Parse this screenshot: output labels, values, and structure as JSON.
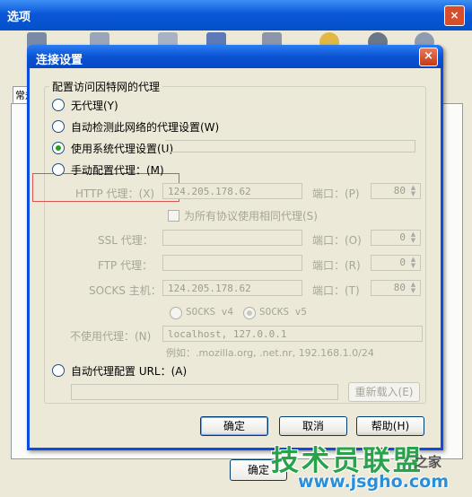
{
  "outer": {
    "title": "选项",
    "tab_label": "常规",
    "ok_label": "确定",
    "close_glyph": "×"
  },
  "dialog": {
    "title": "连接设置",
    "close_glyph": "×",
    "group_title": "配置访问因特网的代理",
    "options": {
      "no_proxy": "无代理(Y)",
      "auto_detect": "自动检测此网络的代理设置(W)",
      "system": "使用系统代理设置(U)",
      "manual": "手动配置代理：(M)",
      "auto_url": "自动代理配置 URL：(A)"
    },
    "selected_option": "system",
    "http": {
      "label": "HTTP 代理：(X)",
      "value": "124.205.178.62",
      "port_label": "端口：(P)",
      "port": "80"
    },
    "same_proxy_label": "为所有协议使用相同代理(S)",
    "ssl": {
      "label": "SSL 代理：",
      "value": "",
      "port_label": "端口：(O)",
      "port": "0"
    },
    "ftp": {
      "label": "FTP 代理：",
      "value": "",
      "port_label": "端口：(R)",
      "port": "0"
    },
    "socks": {
      "label": "SOCKS 主机：",
      "value": "124.205.178.62",
      "port_label": "端口：(T)",
      "port": "80"
    },
    "socks_v4": "SOCKS v4",
    "socks_v5": "SOCKS v5",
    "no_proxy_for_label": "不使用代理：(N)",
    "no_proxy_for_value": "localhost, 127.0.0.1",
    "example": "例如：.mozilla.org, .net.nr, 192.168.1.0/24",
    "reload_label": "重新载入(E)",
    "buttons": {
      "ok": "确定",
      "cancel": "取消",
      "help": "帮助(H)"
    }
  },
  "watermark": {
    "main": "技术员联盟",
    "sub": "www.jsgho.com",
    "side": "之家"
  },
  "colors": {
    "titlebar": "#0a53d4",
    "dialog_bg": "#ece9d8",
    "highlight_box": "#d9534f",
    "watermark_green": "#28a34a",
    "watermark_blue": "#2a8fd8"
  }
}
